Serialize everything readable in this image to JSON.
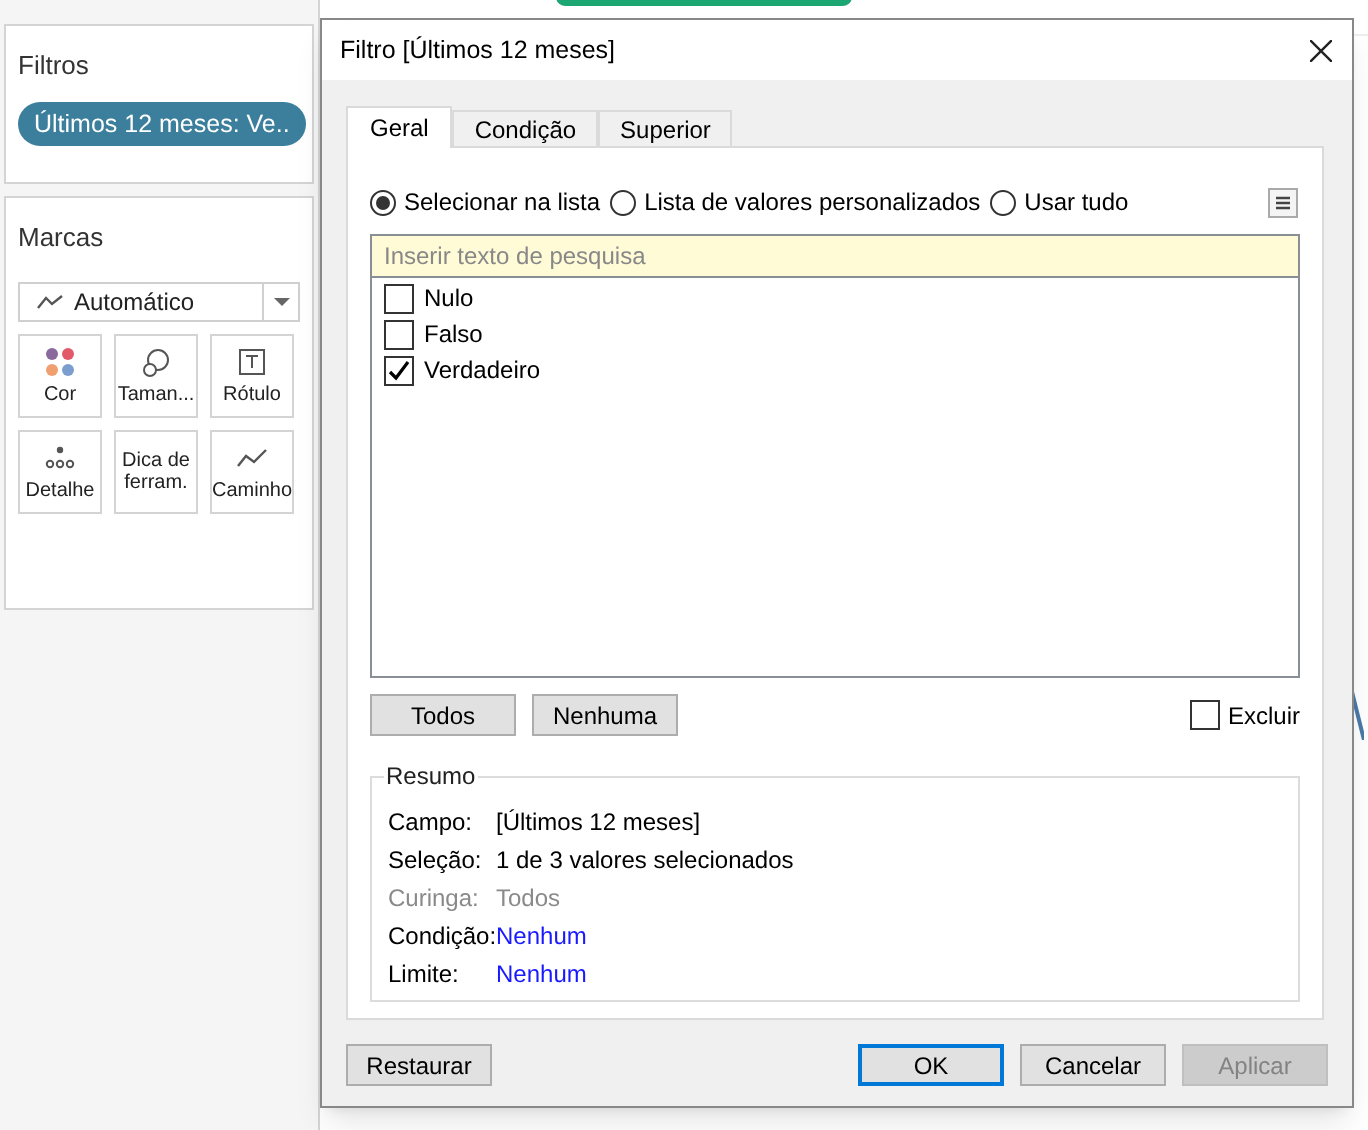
{
  "filters_panel": {
    "title": "Filtros",
    "pill": "Últimos 12 meses: Ve.."
  },
  "marks_panel": {
    "title": "Marcas",
    "mark_type": "Automático",
    "cards": [
      {
        "kind": "color",
        "label": "Cor"
      },
      {
        "kind": "size",
        "label": "Taman..."
      },
      {
        "kind": "label",
        "label": "Rótulo"
      },
      {
        "kind": "detail",
        "label": "Detalhe"
      },
      {
        "kind": "tooltip",
        "label": "Dica de ferram."
      },
      {
        "kind": "path",
        "label": "Caminho"
      }
    ]
  },
  "dialog": {
    "title": "Filtro [Últimos 12 meses]",
    "tabs": [
      {
        "label": "Geral",
        "selected": true
      },
      {
        "label": "Condição",
        "selected": false
      },
      {
        "label": "Superior",
        "selected": false
      }
    ],
    "modes": [
      {
        "label": "Selecionar na lista",
        "selected": true
      },
      {
        "label": "Lista de valores personalizados",
        "selected": false
      },
      {
        "label": "Usar tudo",
        "selected": false
      }
    ],
    "search": {
      "placeholder": "Inserir texto de pesquisa"
    },
    "values": [
      {
        "label": "Nulo",
        "checked": false
      },
      {
        "label": "Falso",
        "checked": false
      },
      {
        "label": "Verdadeiro",
        "checked": true
      }
    ],
    "select_buttons": [
      "Todos",
      "Nenhuma"
    ],
    "exclude": {
      "label": "Excluir",
      "checked": false
    },
    "summary": {
      "title": "Resumo",
      "rows": [
        {
          "label": "Campo:",
          "value": "[Últimos 12 meses]",
          "kind": "normal"
        },
        {
          "label": "Seleção:",
          "value": "1 de 3 valores selecionados",
          "kind": "normal"
        },
        {
          "label": "Curinga:",
          "value": "Todos",
          "kind": "disabled"
        },
        {
          "label": "Condição:",
          "value": "Nenhum",
          "kind": "link"
        },
        {
          "label": "Limite:",
          "value": "Nenhum",
          "kind": "link"
        }
      ]
    },
    "footer_buttons": [
      {
        "label": "Restaurar",
        "kind": "left"
      },
      {
        "label": "OK",
        "kind": "default"
      },
      {
        "label": "Cancelar",
        "kind": "normal"
      },
      {
        "label": "Aplicar",
        "kind": "disabled"
      }
    ]
  }
}
